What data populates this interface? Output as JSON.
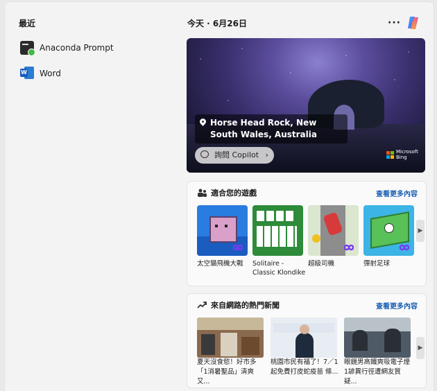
{
  "recent": {
    "title": "最近",
    "items": [
      {
        "label": "Anaconda Prompt",
        "icon": "anaconda-prompt-icon"
      },
      {
        "label": "Word",
        "icon": "word-icon"
      }
    ]
  },
  "header": {
    "date": "今天 · 6月26日",
    "more": "···"
  },
  "hero": {
    "caption": "Horse Head Rock, New South Wales, Australia",
    "ask_label": "詢問 Copilot",
    "bing_brand": "Microsoft Bing"
  },
  "games": {
    "title": "適合您的遊戲",
    "see_more": "查看更多內容",
    "items": [
      {
        "label": "太空貓飛機大戰"
      },
      {
        "label": "Solitaire - Classic Klondike"
      },
      {
        "label": "超級司機"
      },
      {
        "label": "彈射足球"
      }
    ]
  },
  "news": {
    "title": "來自網路的熱門新聞",
    "see_more": "查看更多內容",
    "items": [
      {
        "label": "夏天沒食慾！好市多「1消暑聖品」清爽又..."
      },
      {
        "label": "桃園市民有福了！7／1起免費打皮蛇疫苗 條..."
      },
      {
        "label": "眼鏡男高鐵爽吸電子煙 1諺異行徑遭網友質疑..."
      }
    ]
  }
}
